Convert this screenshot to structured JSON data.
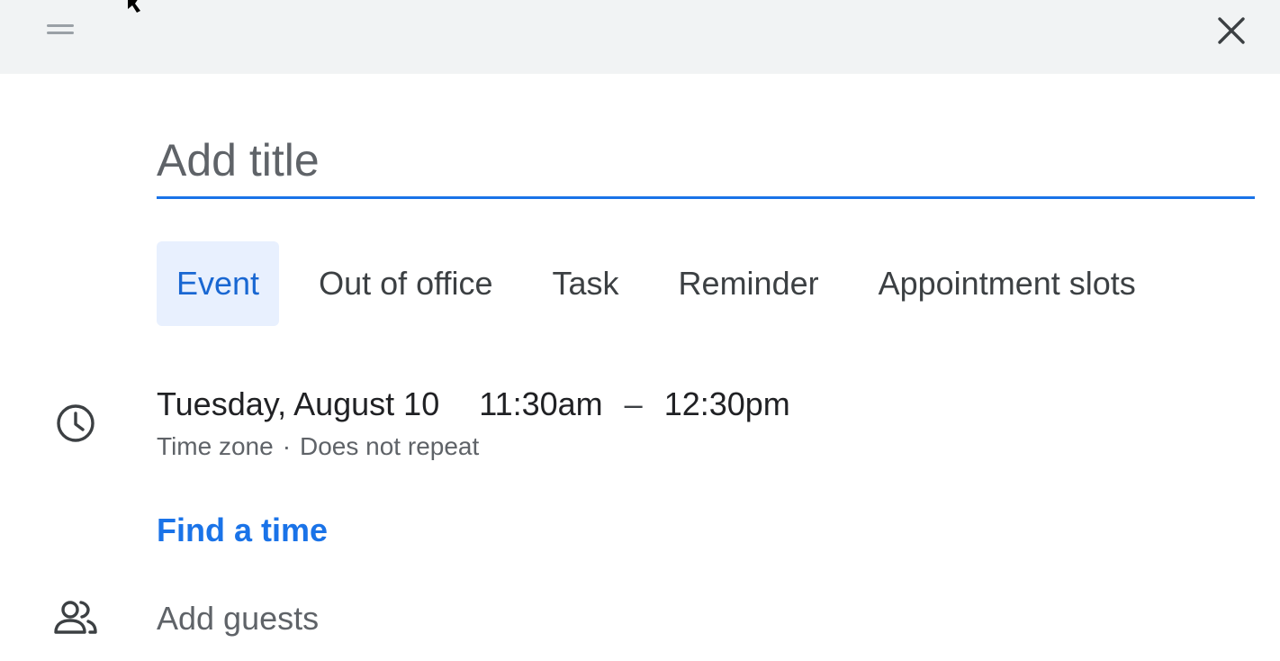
{
  "title_field": {
    "placeholder": "Add title",
    "value": ""
  },
  "tabs": [
    {
      "label": "Event",
      "active": true
    },
    {
      "label": "Out of office",
      "active": false
    },
    {
      "label": "Task",
      "active": false
    },
    {
      "label": "Reminder",
      "active": false
    },
    {
      "label": "Appointment slots",
      "active": false
    }
  ],
  "datetime": {
    "date": "Tuesday, August 10",
    "start": "11:30am",
    "separator": "–",
    "end": "12:30pm"
  },
  "details": {
    "time_zone": "Time zone",
    "dot": "·",
    "repeat": "Does not repeat"
  },
  "find_time_label": "Find a time",
  "guests": {
    "placeholder": "Add guests",
    "value": ""
  },
  "icons": {
    "drag": "drag-handle-icon",
    "close": "close-icon",
    "clock": "clock-icon",
    "people": "people-icon"
  },
  "colors": {
    "accent": "#1a73e8",
    "active_tab_bg": "#e8f0fe",
    "active_tab_text": "#1967d2",
    "header_bg": "#f1f3f4"
  }
}
